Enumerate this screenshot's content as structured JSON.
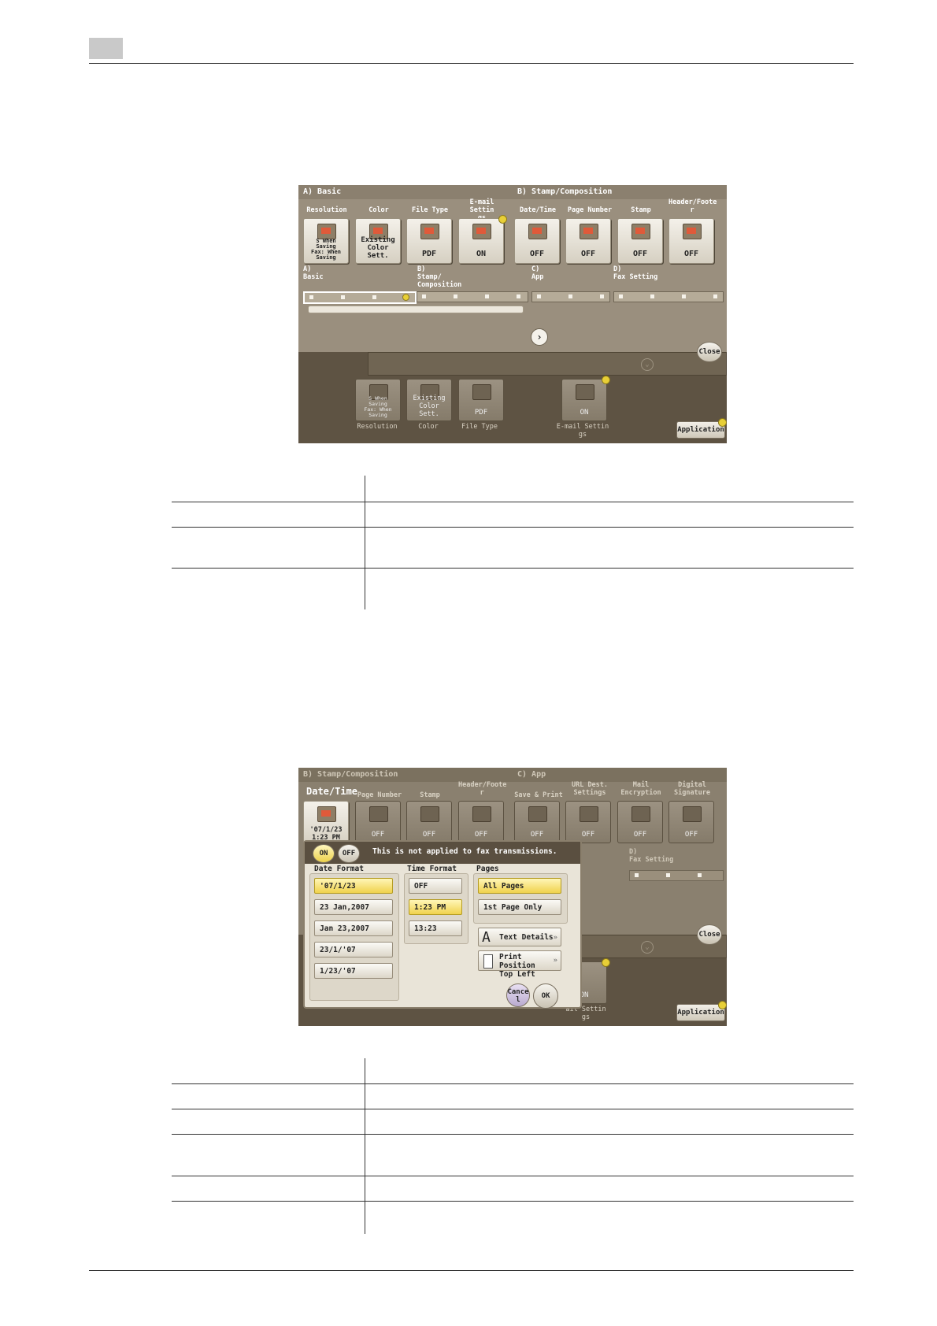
{
  "shot1": {
    "sections": {
      "a": "A)  Basic",
      "b": "B)  Stamp/Composition"
    },
    "labels": {
      "resolution": "Resolution",
      "color": "Color",
      "file_type": "File Type",
      "email_settings": "E-mail Settin\ngs",
      "date_time": "Date/Time",
      "page_number": "Page Number",
      "stamp": "Stamp",
      "header_footer": "Header/Foote\nr"
    },
    "values": {
      "resolution": "S When\nSaving\nFax: When\nSaving",
      "color": "Existing\nColor Sett.",
      "file_type": "PDF",
      "email_settings": "ON",
      "date_time": "OFF",
      "page_number": "OFF",
      "stamp": "OFF",
      "header_footer": "OFF"
    },
    "nav_labels": {
      "a": "A)\nBasic",
      "b": "B)\nStamp/\nComposition",
      "c": "C)\nApp",
      "d": "D)\nFax Setting"
    },
    "close_label": "Close",
    "lower_labels": {
      "resolution": "Resolution",
      "color": "Color",
      "file_type": "File Type",
      "email_settings": "E-mail Settin\ngs"
    },
    "lower_values": {
      "resolution": "S When\nSaving\nFax: When\nSaving",
      "color": "Existing\nColor Sett.",
      "file_type": "PDF",
      "email_settings": "ON"
    },
    "application_label": "Application"
  },
  "shot2": {
    "sections": {
      "b": "B)  Stamp/Composition",
      "c": "C)  App"
    },
    "labels": {
      "date_time": "Date/Time",
      "page_number": "Page Number",
      "stamp": "Stamp",
      "header_footer": "Header/Foote\nr",
      "save_print": "Save & Print",
      "url_dest": "URL Dest.\nSettings",
      "mail_enc": "Mail\nEncryption",
      "digital_sig": "Digital\nSignature"
    },
    "values": {
      "date_time": "'07/1/23\n1:23 PM",
      "page_number": "OFF",
      "stamp": "OFF",
      "header_footer": "OFF",
      "save_print": "OFF",
      "url_dest": "OFF",
      "mail_enc": "OFF",
      "digital_sig": "OFF"
    },
    "on_label": "ON",
    "off_label": "OFF",
    "notice": "This is not applied to fax transmissions.",
    "date_format_title": "Date Format",
    "date_formats": [
      "'07/1/23",
      "23 Jan,2007",
      "Jan 23,2007",
      "23/1/'07",
      "1/23/'07"
    ],
    "time_format_title": "Time Format",
    "time_formats": [
      "OFF",
      "1:23 PM",
      "13:23"
    ],
    "pages_title": "Pages",
    "pages": [
      "All Pages",
      "1st Page Only"
    ],
    "text_details": "Text Details",
    "print_position": "Print Position\nTop Left",
    "cancel_label": "Cance\nl",
    "ok_label": "OK",
    "behind_labels": {
      "d": "D)\nFax Setting",
      "close": "Close",
      "on": "ON",
      "email": "ail Settin\ngs",
      "application": "Application"
    }
  }
}
